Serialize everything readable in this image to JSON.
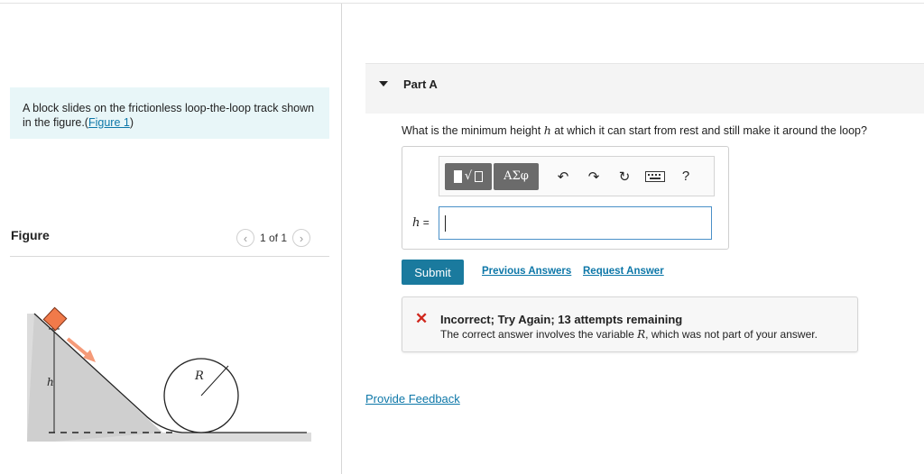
{
  "intro": {
    "text": "A block slides on the frictionless loop-the-loop track shown in the figure.",
    "link_prefix": "(",
    "link": "Figure 1",
    "link_suffix": ")"
  },
  "figure": {
    "title": "Figure",
    "pager": "1 of 1",
    "label_h": "h",
    "label_R": "R",
    "colors": {
      "block": "#f07a4a",
      "arrow": "#f59a78",
      "track": "#dcdcdc"
    }
  },
  "part": {
    "title": "Part A",
    "question_before": "What is the minimum height ",
    "question_var": "h",
    "question_after": " at which it can start from rest and still make it around the loop?"
  },
  "toolbar": {
    "template_icon": "√▢",
    "greek_label": "ΑΣφ",
    "undo_icon": "undo-arrow-icon",
    "redo_icon": "redo-arrow-icon",
    "reset_icon": "reset-icon",
    "keyboard_icon": "keyboard-icon",
    "help_label": "?"
  },
  "answer": {
    "var": "h",
    "eq": " =",
    "value": ""
  },
  "actions": {
    "submit": "Submit",
    "previous": "Previous Answers",
    "request": "Request Answer"
  },
  "feedback": {
    "title": "Incorrect; Try Again; 13 attempts remaining",
    "msg_before": "The correct answer involves the variable ",
    "msg_var": "R",
    "msg_after": ", which was not part of your answer.",
    "icon_color": "#d0271d"
  },
  "provide_feedback": "Provide Feedback"
}
